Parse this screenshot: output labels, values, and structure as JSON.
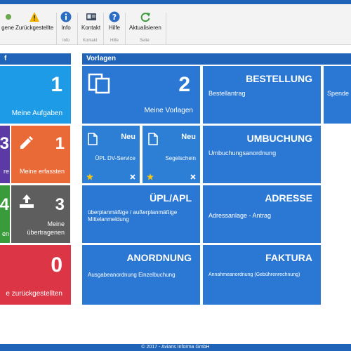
{
  "ribbon": {
    "buttons": [
      {
        "label": "gene"
      },
      {
        "label": "Zurückgestellte"
      },
      {
        "label": "Info"
      },
      {
        "label": "Kontakt"
      },
      {
        "label": "Hilfe"
      },
      {
        "label": "Aktualisieren"
      }
    ],
    "groups": {
      "info": "Info",
      "kontakt": "Kontakt",
      "hilfe": "Hilfe",
      "seite": "Seite"
    }
  },
  "left_panel": {
    "header": "f",
    "tiles": {
      "aufgaben": {
        "count": "1",
        "label": "Meine Aufgaben"
      },
      "purple": {
        "count": "3",
        "label": "re"
      },
      "erfasste": {
        "count": "1",
        "label": "Meine erfassten"
      },
      "green": {
        "count": "4",
        "label": "en"
      },
      "uebertragen": {
        "count": "3",
        "label1": "Meine",
        "label2": "übertragenen"
      },
      "zurueck": {
        "count": "0",
        "label": "e zurückgestellten"
      }
    }
  },
  "vorlagen": {
    "header": "Vorlagen",
    "meine_vorlagen": {
      "count": "2",
      "label": "Meine Vorlagen"
    },
    "bestellung": {
      "title": "BESTELLUNG",
      "sub": "Bestellantrag"
    },
    "spende": {
      "sub": "Spende"
    },
    "upl_dv": {
      "badge": "Neu",
      "label": "ÜPL DV-Service"
    },
    "segelschein": {
      "badge": "Neu",
      "label": "Segelschein"
    },
    "umbuchung": {
      "title": "UMBUCHUNG",
      "sub": "Umbuchungsanordnung"
    },
    "upl_apl": {
      "title": "ÜPL/APL",
      "sub": "überplanmäßige / außerplanmäßige Mittelanmeldung"
    },
    "adresse": {
      "title": "ADRESSE",
      "sub": "Adressanlage - Antrag"
    },
    "anordnung": {
      "title": "ANORDNUNG",
      "sub": "Ausgabeanordnung Einzelbuchung"
    },
    "faktura": {
      "title": "FAKTURA",
      "sub": "Annahmeanordnung (Gebührenrechnung)"
    }
  },
  "footer": {
    "text": "© 2017 - Avians Informa GmbH"
  },
  "colors": {
    "brand": "#1f64b8",
    "tile_blue": "#2b78d4",
    "cyan": "#1e9be6",
    "orange": "#ea6a37",
    "grey": "#5e5e5e",
    "green": "#3a9b3a",
    "purple": "#5c3aa5",
    "red": "#dc3545"
  }
}
